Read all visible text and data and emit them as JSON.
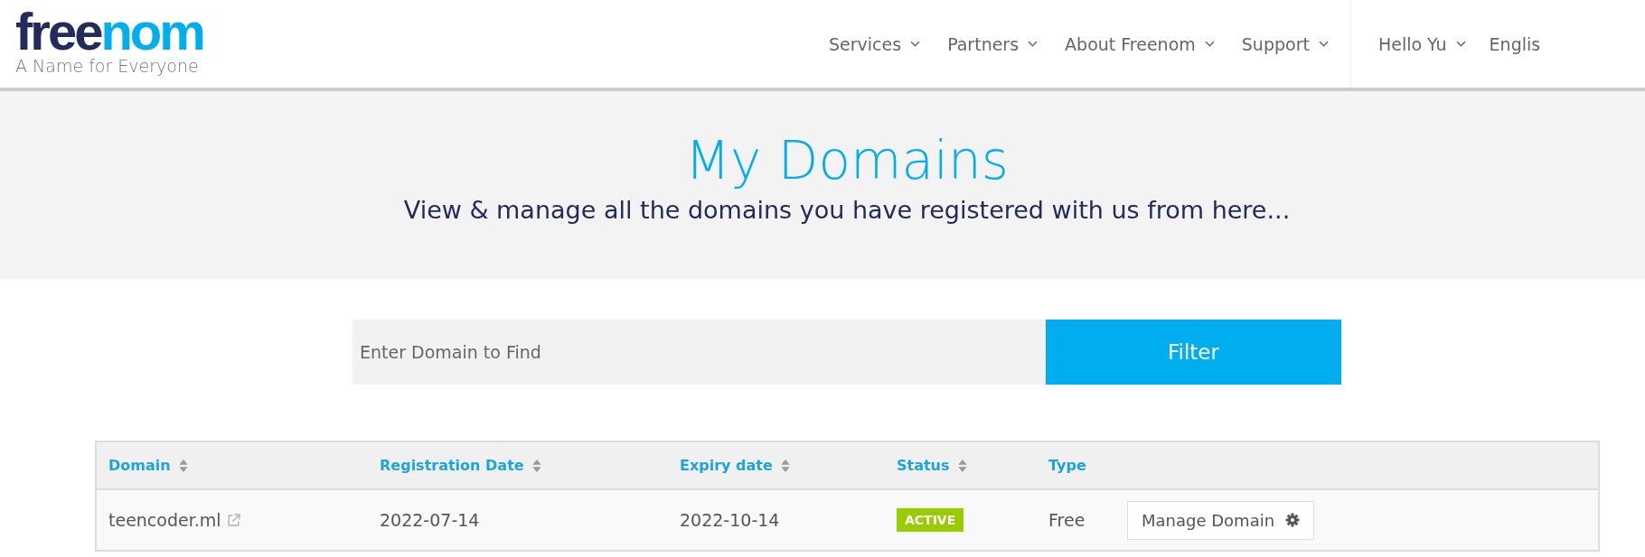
{
  "logo": {
    "part_1": "free",
    "part_2": "nom",
    "tagline": "A Name for Everyone"
  },
  "nav": [
    {
      "label": "Services"
    },
    {
      "label": "Partners"
    },
    {
      "label": "About Freenom"
    },
    {
      "label": "Support"
    }
  ],
  "account": [
    {
      "label": "Hello Yu",
      "dropdown": true
    },
    {
      "label": "Englis",
      "dropdown": false
    }
  ],
  "hero": {
    "title": "My Domains",
    "subtitle": "View & manage all the domains you have registered with us from here..."
  },
  "search": {
    "placeholder": "Enter Domain to Find",
    "button": "Filter"
  },
  "table": {
    "columns": [
      {
        "label": "Domain",
        "sortable": true
      },
      {
        "label": "Registration Date",
        "sortable": true
      },
      {
        "label": "Expiry date",
        "sortable": true
      },
      {
        "label": "Status",
        "sortable": true
      },
      {
        "label": "Type",
        "sortable": false
      }
    ],
    "rows": [
      {
        "domain": "teencoder.ml",
        "registration_date": "2022-07-14",
        "expiry_date": "2022-10-14",
        "status": "ACTIVE",
        "type": "Free",
        "action": "Manage Domain"
      }
    ]
  }
}
